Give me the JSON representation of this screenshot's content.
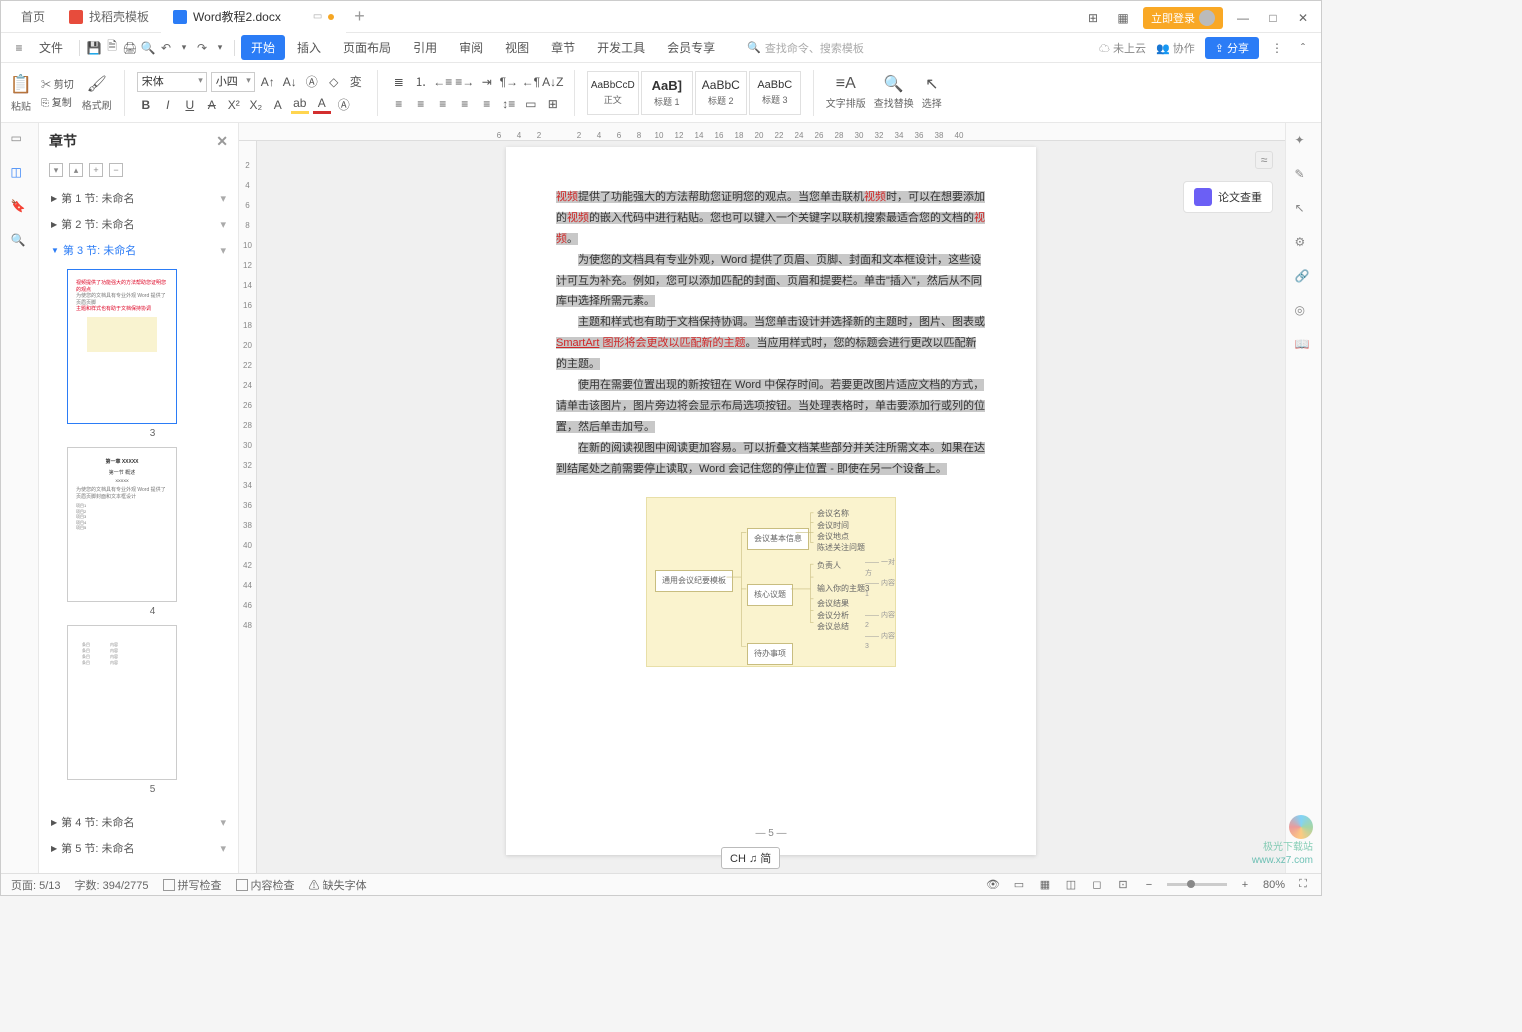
{
  "tabs": {
    "home": "首页",
    "template": "找稻壳模板",
    "doc": "Word教程2.docx"
  },
  "window": {
    "login": "立即登录"
  },
  "file_menu": "文件",
  "menus": [
    "开始",
    "插入",
    "页面布局",
    "引用",
    "审阅",
    "视图",
    "章节",
    "开发工具",
    "会员专享"
  ],
  "search_ph": "查找命令、搜索模板",
  "cloud": "未上云",
  "collab": "协作",
  "share": "分享",
  "clipboard": {
    "paste": "粘贴",
    "cut": "剪切",
    "copy": "复制",
    "fmt": "格式刷"
  },
  "font": {
    "name": "宋体",
    "size": "小四",
    "bold_group": "B I U"
  },
  "styles": [
    {
      "prev": "AaBbCcD",
      "name": "正文"
    },
    {
      "prev": "AaB]",
      "name": "标题 1"
    },
    {
      "prev": "AaBbC",
      "name": "标题 2"
    },
    {
      "prev": "AaBbC",
      "name": "标题 3"
    }
  ],
  "rib": {
    "layout": "文字排版",
    "find": "查找替换",
    "select": "选择"
  },
  "panel": {
    "title": "章节",
    "sections": [
      "第 1 节: 未命名",
      "第 2 节: 未命名",
      "第 3 节: 未命名",
      "第 4 节: 未命名",
      "第 5 节: 未命名"
    ],
    "thumb_nums": [
      "3",
      "4",
      "5"
    ]
  },
  "ruler_h": [
    "6",
    "4",
    "2",
    "",
    "2",
    "4",
    "6",
    "8",
    "10",
    "12",
    "14",
    "16",
    "18",
    "20",
    "22",
    "24",
    "26",
    "28",
    "30",
    "32",
    "34",
    "36",
    "38",
    "40"
  ],
  "ruler_v": [
    "",
    "2",
    "4",
    "6",
    "8",
    "10",
    "12",
    "14",
    "16",
    "18",
    "20",
    "22",
    "24",
    "26",
    "28",
    "30",
    "32",
    "34",
    "36",
    "38",
    "40",
    "42",
    "44",
    "46",
    "48"
  ],
  "doc": {
    "p1_a": "视频",
    "p1_b": "提供了功能强大的方法帮助您证明您的观点。当您单击联机",
    "p1_c": "视频",
    "p1_d": "时，可以在想要添加的",
    "p1_e": "视频",
    "p1_f": "的嵌入代码中进行粘贴。您也可以键入一个关键字以联机搜索最适合您的文档的",
    "p1_g": "视频",
    "p1_h": "。",
    "p2": "为使您的文档具有专业外观，Word 提供了页眉、页脚、封面和文本框设计，这些设计可互为补充。例如，您可以添加匹配的封面、页眉和提要栏。单击\"插入\"，然后从不同库中选择所需元素。",
    "p3_a": "主题和样式也有助于文档保持协调。当您单击设计并选择新的主题时，图片、图表或 ",
    "p3_b": "SmartArt",
    "p3_c": " 图形将会更改以匹配新的主题",
    "p3_d": "。当应用样式时，您的标题会进行更改以匹配新的主题。",
    "p4": "使用在需要位置出现的新按钮在 Word 中保存时间。若要更改图片适应文档的方式，请单击该图片，图片旁边将会显示布局选项按钮。当处理表格时，单击要添加行或列的位置，然后单击加号。",
    "p5": "在新的阅读视图中阅读更加容易。可以折叠文档某些部分并关注所需文本。如果在达到结尾处之前需要停止读取，Word 会记住您的停止位置 - 即使在另一个设备上。",
    "dia": {
      "center": "通用会议纪要模板",
      "n1": "会议基本信息",
      "n2": "核心议题",
      "n3": "待办事项",
      "r1": "会议名称",
      "r2": "会议时间",
      "r3": "会议地点",
      "r4": "陈述关注问题",
      "r5": "负责人",
      "r6": "输入你的主题3",
      "r7": "会议结果",
      "r8": "会议分析",
      "r9": "会议总结",
      "t1": "一对方",
      "t2": "内容 1",
      "t3": "内容 2",
      "t4": "内容 3"
    },
    "pnum": "— 5 —"
  },
  "float": "论文查重",
  "ime": "CH ♫ 简",
  "status": {
    "page": "页面: 5/13",
    "words": "字数: 394/2775",
    "spell": "拼写检查",
    "content": "内容检查",
    "font": "缺失字体",
    "zoom": "80%"
  },
  "wm": {
    "l1": "极光下载站",
    "l2": "www.xz7.com"
  }
}
